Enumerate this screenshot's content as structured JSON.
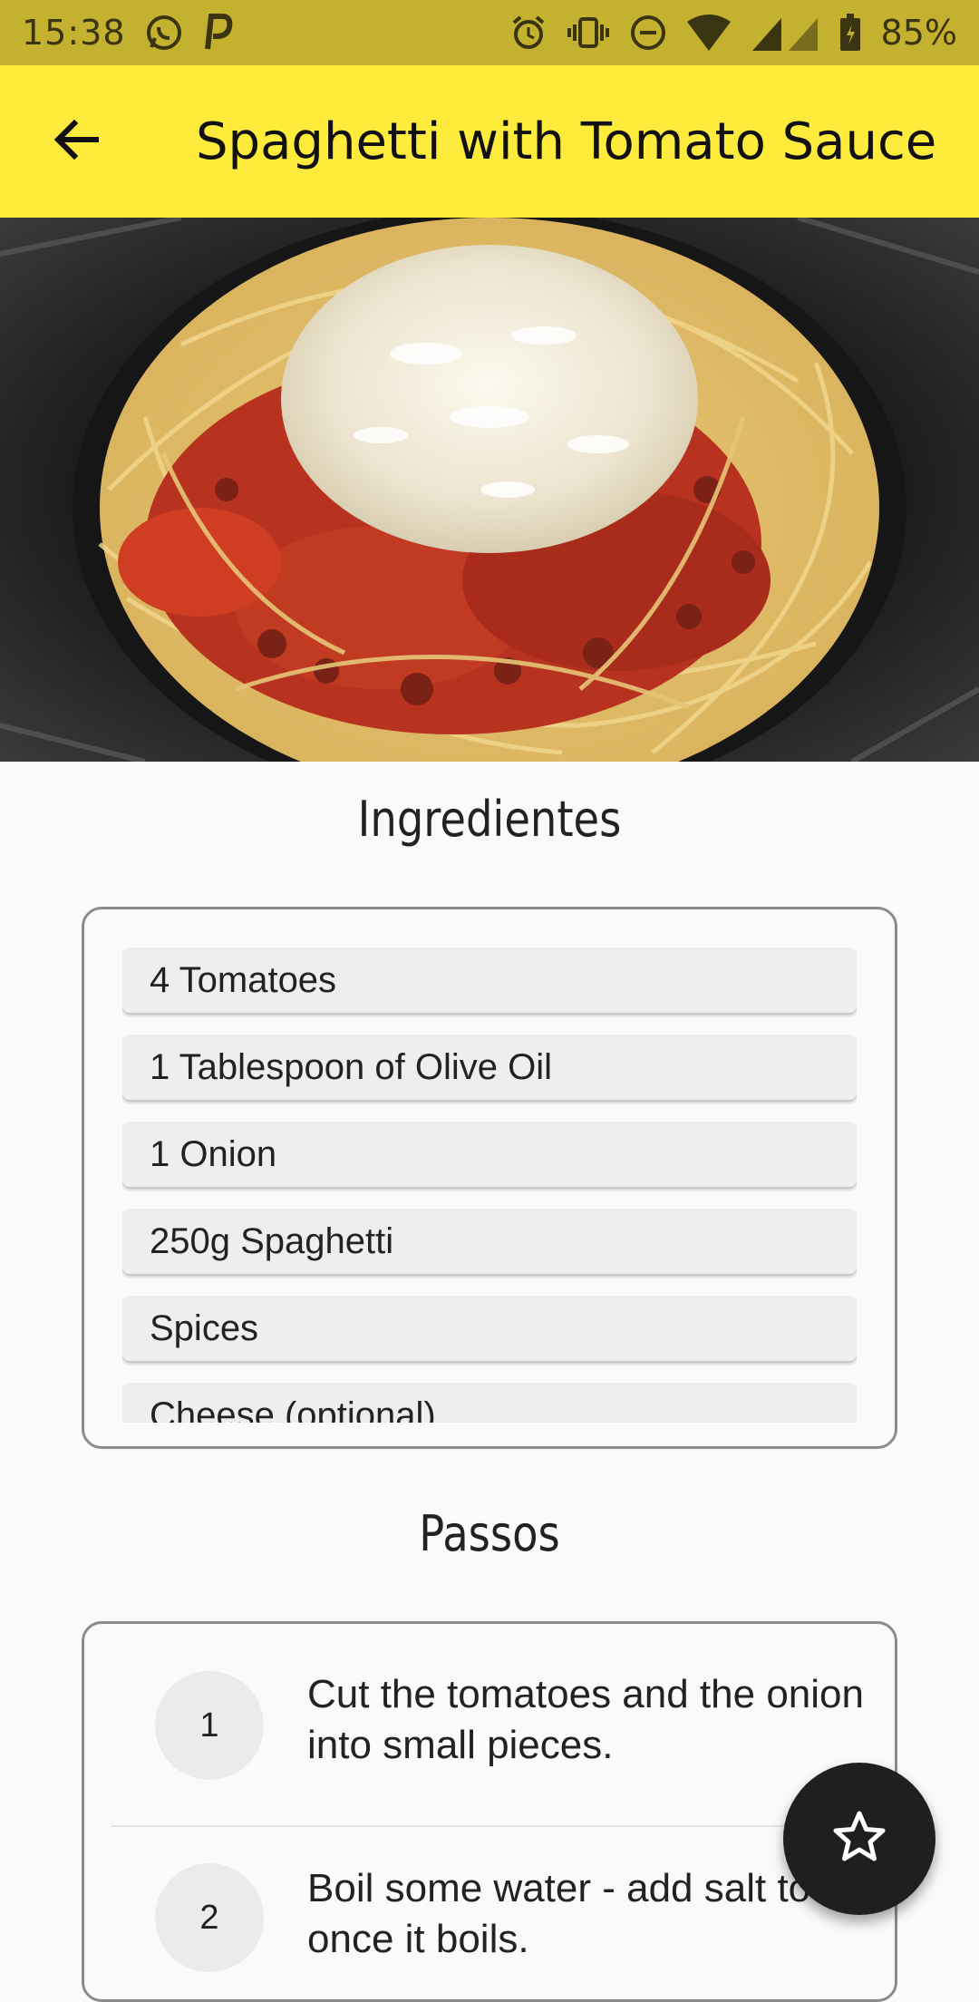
{
  "status_bar": {
    "time": "15:38",
    "battery": "85%",
    "icons": [
      "whatsapp-icon",
      "p-app-icon",
      "alarm-icon",
      "vibrate-icon",
      "do-not-disturb-icon",
      "wifi-icon",
      "signal-icon",
      "battery-icon"
    ]
  },
  "app_bar": {
    "title": "Spaghetti with Tomato Sauce",
    "back_icon": "arrow-back-icon",
    "color": "#ffeb3b"
  },
  "ingredients": {
    "title": "Ingredientes",
    "items": [
      "4 Tomatoes",
      "1 Tablespoon of Olive Oil",
      "1 Onion",
      "250g Spaghetti",
      "Spices",
      "Cheese (optional)"
    ]
  },
  "steps": {
    "title": "Passos",
    "items": [
      {
        "number": "1",
        "text": "Cut the tomatoes and the onion into small pieces."
      },
      {
        "number": "2",
        "text": "Boil some water - add salt to it once it boils."
      }
    ]
  },
  "fab": {
    "icon": "star-outline-icon"
  }
}
